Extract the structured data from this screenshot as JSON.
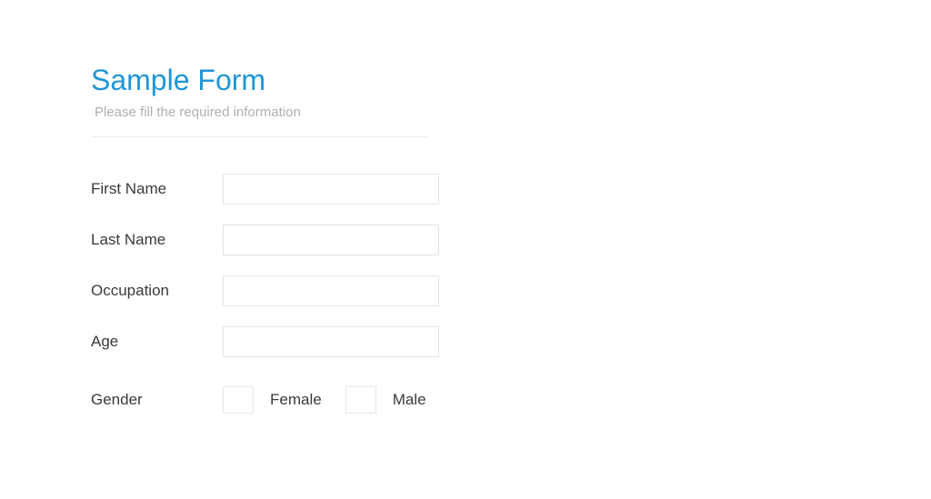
{
  "form": {
    "title": "Sample Form",
    "subtitle": "Please fill the required information",
    "fields": {
      "firstName": {
        "label": "First Name",
        "value": ""
      },
      "lastName": {
        "label": "Last Name",
        "value": ""
      },
      "occupation": {
        "label": "Occupation",
        "value": ""
      },
      "age": {
        "label": "Age",
        "value": ""
      },
      "gender": {
        "label": "Gender",
        "options": {
          "female": "Female",
          "male": "Male"
        }
      }
    }
  },
  "colors": {
    "titleBlue": "#2196d6",
    "subtitleGray": "#b0b0b0",
    "borderGray": "#e5e5e5",
    "textDark": "#3a3a3a"
  }
}
